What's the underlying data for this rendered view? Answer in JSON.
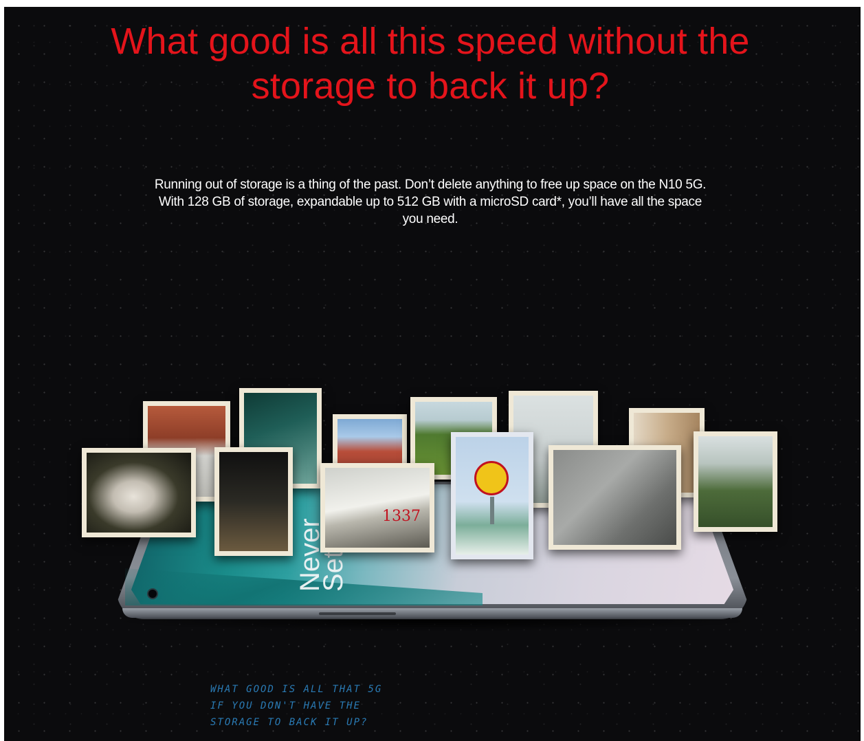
{
  "headline": "What good is all this speed without the storage to back it up?",
  "body": "Running out of storage is a thing of the past. Don’t delete anything to free up space on the N10 5G. With 128 GB of storage, expandable up to 512 GB with a microSD card*, you’ll have all the space you need.",
  "colors": {
    "headline": "#e4141b",
    "background": "#0b0b0d",
    "body_text": "#ffffff",
    "handwriting": "#2a7bb5"
  },
  "phone": {
    "screen_text": "Never Settle"
  },
  "photos": [
    {
      "name": "brick-building-photo"
    },
    {
      "name": "teal-card-photo"
    },
    {
      "name": "apartment-balconies-photo"
    },
    {
      "name": "cows-field-photo"
    },
    {
      "name": "tree-sky-photo"
    },
    {
      "name": "window-blinds-photo"
    },
    {
      "name": "statue-night-photo"
    },
    {
      "name": "night-plants-photo"
    },
    {
      "name": "wall-1337-photo"
    },
    {
      "name": "ring-side-sign-photo"
    },
    {
      "name": "sneakers-pavement-photo"
    },
    {
      "name": "green-park-photo"
    }
  ],
  "wall_number": "1337",
  "handwritten_note": [
    "WHAT GOOD IS ALL THAT 5G",
    "IF YOU DON'T HAVE THE",
    "STORAGE TO BACK IT UP?"
  ]
}
